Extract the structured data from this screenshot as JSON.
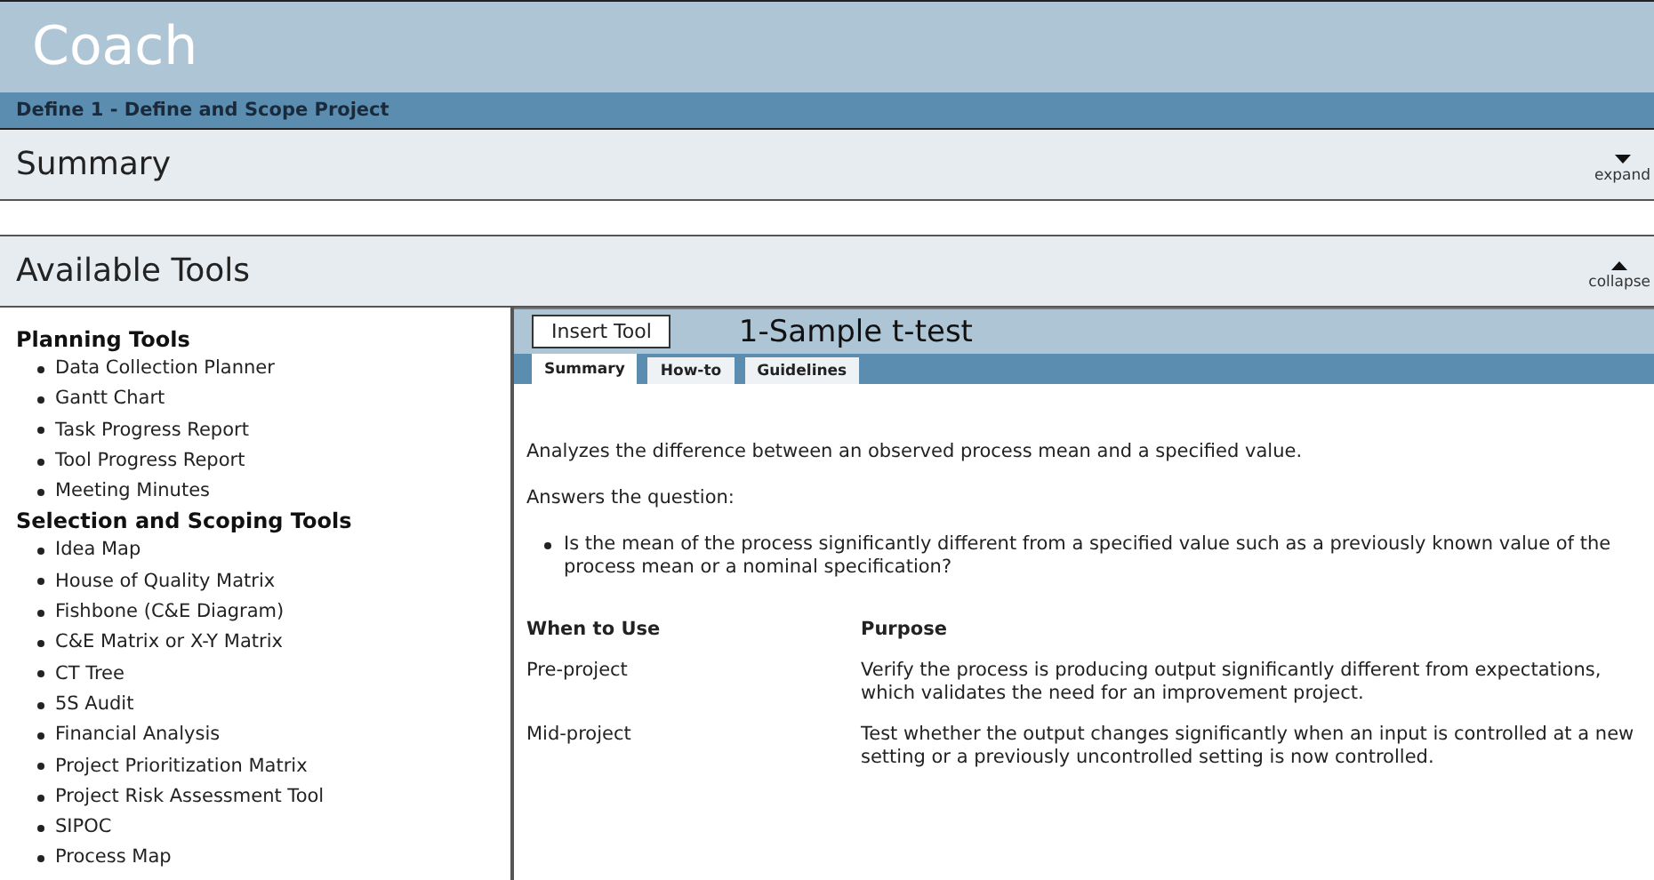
{
  "app_title": "Coach",
  "breadcrumb": "Define 1 - Define and Scope Project",
  "sections": [
    {
      "title": "Summary",
      "expanded": false,
      "toggle_label": "expand"
    },
    {
      "title": "Available Tools",
      "expanded": true,
      "toggle_label": "collapse"
    }
  ],
  "tool_groups": [
    {
      "title": "Planning Tools",
      "items": [
        "Data Collection Planner",
        "Gantt Chart",
        "Task Progress Report",
        "Tool Progress Report",
        "Meeting Minutes"
      ]
    },
    {
      "title": "Selection and Scoping Tools",
      "items": [
        "Idea Map",
        "House of Quality Matrix",
        "Fishbone (C&E Diagram)",
        "C&E Matrix or X-Y Matrix",
        "CT Tree",
        "5S Audit",
        "Financial Analysis",
        "Project Prioritization Matrix",
        "Project Risk Assessment Tool",
        "SIPOC",
        "Process Map"
      ]
    }
  ],
  "tool_panel": {
    "insert_button": "Insert Tool",
    "title": "1-Sample t-test",
    "tabs": [
      {
        "label": "Summary",
        "selected": true
      },
      {
        "label": "How-to",
        "selected": false
      },
      {
        "label": "Guidelines",
        "selected": false
      }
    ],
    "description": "Analyzes the difference between an observed process mean and a specified value.",
    "question_label": "Answers the question:",
    "questions": [
      "Is the mean of the process significantly different from a specified value such as a previously known value of the process mean or a nominal specification?"
    ],
    "table": {
      "columns": [
        "When to Use",
        "Purpose"
      ],
      "rows": [
        [
          "Pre-project",
          "Verify the process is producing output significantly different from expectations, which validates the need for an improvement project."
        ],
        [
          "Mid-project",
          "Test whether the output changes significantly when an input is controlled at a new setting or a previously uncontrolled setting is now controlled."
        ]
      ]
    }
  }
}
